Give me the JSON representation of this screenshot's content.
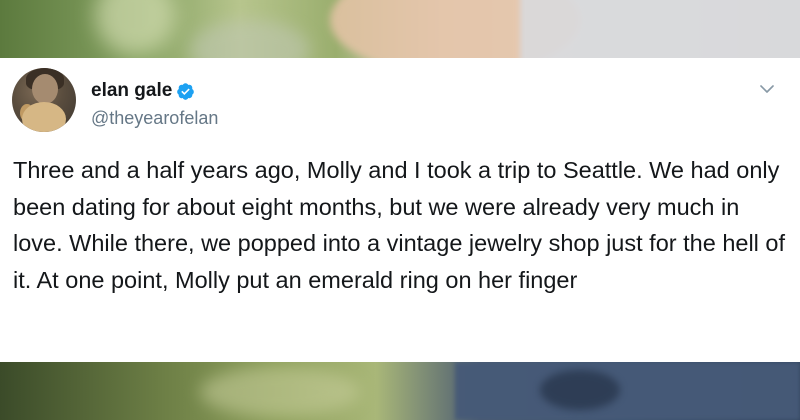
{
  "background": {
    "photo": "blurred-outdoor-photo"
  },
  "tweet": {
    "display_name": "elan gale",
    "handle": "@theyearofelan",
    "verified": true,
    "text": "Three and a half years ago, Molly and I took a trip to Seattle. We had only been dating for about eight months, but we were already very much in love. While there, we popped into a vintage jewelry shop just for the hell of it. At one point, Molly put an emerald ring on her finger",
    "icons": {
      "verified": "verified-badge-icon",
      "menu": "chevron-down-icon"
    },
    "colors": {
      "verified": "#1da1f2",
      "text": "#14171a",
      "secondary": "#657786"
    }
  }
}
